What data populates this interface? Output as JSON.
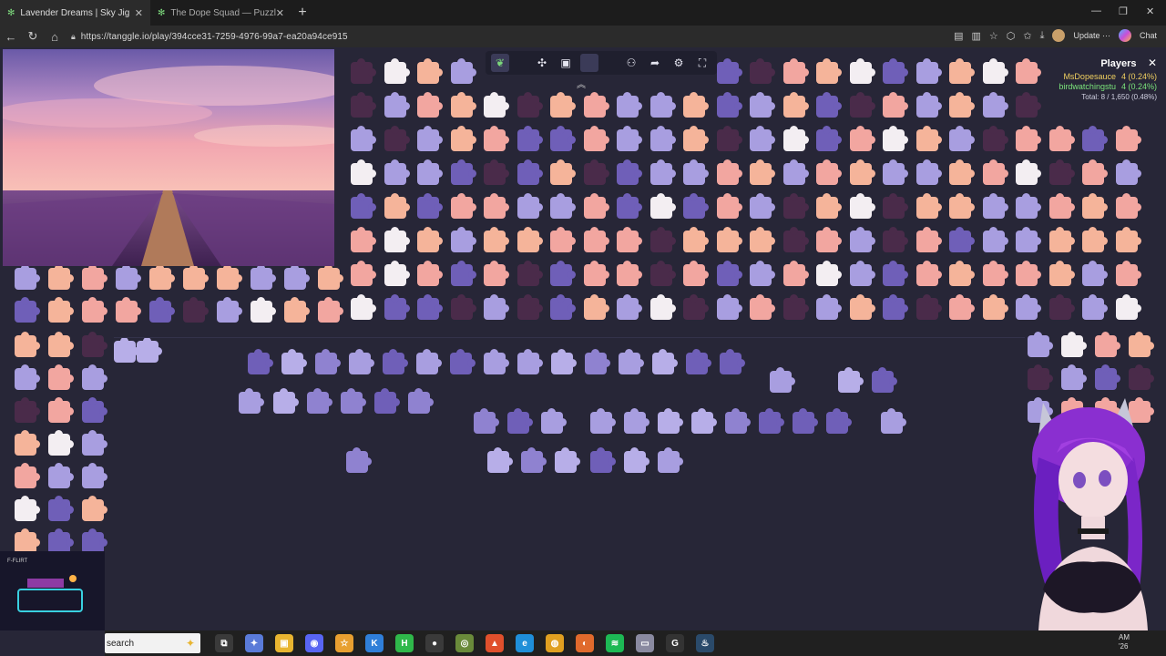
{
  "browser": {
    "tabs": [
      {
        "title": "Lavender Dreams | Sky Jig",
        "active": true
      },
      {
        "title": "The Dope Squad — Puzzles",
        "active": false
      }
    ],
    "new_tab": "+",
    "url": "https://tanggle.io/play/394cce31-7259-4976-99a7-ea20a94ce915",
    "update_label": "Update",
    "chat_label": "Chat"
  },
  "game": {
    "players_panel": {
      "title": "Players",
      "players": [
        {
          "name": "MsDopesauce",
          "score": "4 (0.24%)",
          "color": "#f0d060"
        },
        {
          "name": "birdwatchingstu",
          "score": "4 (0.24%)",
          "color": "#7be57b"
        }
      ],
      "total": "Total: 8 / 1,650 (0.48%)"
    },
    "toolbar_icons": [
      "leaf-icon",
      "puzzle-outline-icon",
      "image-preview-icon",
      "blank-icon",
      "players-icon",
      "share-icon",
      "settings-icon",
      "fullscreen-icon"
    ],
    "collapse_icon": "chevron-up-icon",
    "overlay_tag": "F-FLIRT"
  },
  "taskbar": {
    "search_placeholder": "search",
    "clock_line1": "AM",
    "clock_line2": "'26",
    "apps": [
      "task-view-icon",
      "copilot-icon",
      "file-explorer-icon",
      "discord-icon",
      "star-app-icon",
      "app-k-icon",
      "app-h-icon",
      "obs-icon",
      "app-circle-icon",
      "brave-icon",
      "edge-icon",
      "chrome-icon",
      "firefox-icon",
      "spotify-icon",
      "app-window-icon",
      "app-g-icon",
      "steam-icon"
    ]
  },
  "colors": {
    "background": "#272637",
    "piece_pink": "#f2a6a0",
    "piece_peach": "#f5b49a",
    "piece_lavender": "#a89ee0",
    "piece_purple": "#6f5fb8",
    "piece_dark": "#4a2b4a",
    "piece_white": "#f3eef2"
  }
}
